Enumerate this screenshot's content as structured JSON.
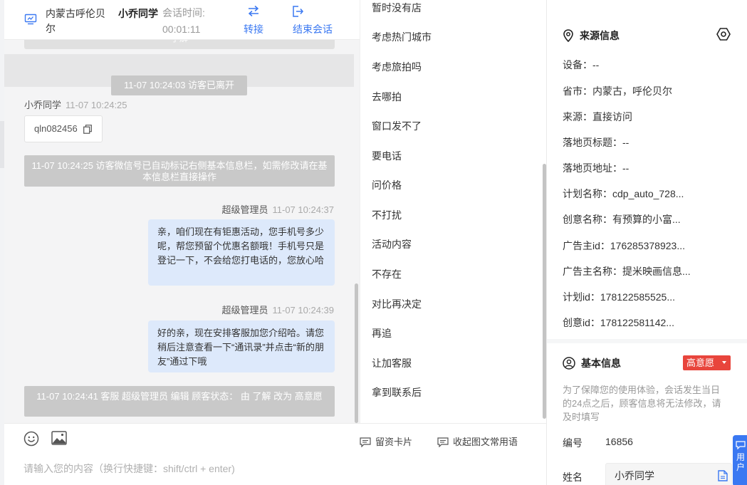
{
  "header": {
    "location": "内蒙古呼伦贝尔",
    "visitor_name": "小乔同学",
    "time_label": "会话时间:",
    "time_value": "00:01:11",
    "transfer_label": "转接",
    "end_label": "结束会话"
  },
  "chat": {
    "cut_text": "了解",
    "left_event": "11-07 10:24:03 访客已离开",
    "visitor_meta": {
      "name": "小乔同学",
      "time": "11-07 10:24:25"
    },
    "wechat_id": "qln082456",
    "system_note_1": "11-07 10:24:25 访客微信号已自动标记右侧基本信息栏，如需修改请在基本信息栏直接操作",
    "agent_msg_1": {
      "name": "超级管理员",
      "time": "11-07 10:24:37",
      "text": "亲，咱们现在有钜惠活动，您手机号多少呢，帮您预留个优惠名额哦！手机号只是登记一下，不会给您打电话的，您放心哈"
    },
    "agent_msg_2": {
      "name": "超级管理员",
      "time": "11-07 10:24:39",
      "text": "好的亲，现在安排客服加您介绍哈。请您稍后注意查看一下“通讯录”并点击“新的朋友”通过下哦"
    },
    "system_note_2": "11-07 10:24:41 客服 超级管理员 编辑 顾客状态： 由 了解 改为 高意愿"
  },
  "composer": {
    "card_label": "留资卡片",
    "phrase_label": "收起图文常用语",
    "placeholder": "请输入您的内容（换行快捷键：shift/ctrl + enter)"
  },
  "quick_replies": [
    "暂时没有店",
    "考虑热门城市",
    "考虑旅拍吗",
    "去哪拍",
    "窗口发不了",
    "要电话",
    "问价格",
    "不打扰",
    "活动内容",
    "不存在",
    "对比再决定",
    "再追",
    "让加客服",
    "拿到联系后"
  ],
  "source_info": {
    "title": "来源信息",
    "rows": [
      "设备：--",
      "省市：内蒙古，呼伦贝尔",
      "来源：直接访问",
      "落地页标题：--",
      "落地页地址：--",
      "计划名称：cdp_auto_728...",
      "创意名称：有预算的小富...",
      "广告主id：176285378923...",
      "广告主名称：提米映画信息...",
      "计划id：178122585525...",
      "创意id：178122581142..."
    ]
  },
  "basic_info": {
    "title": "基本信息",
    "intent_badge": "高意愿",
    "note": "为了保障您的使用体验，会话发生当日的24点之后，顾客信息将无法修改，请及时填写",
    "id_label": "编号",
    "id_value": "16856",
    "name_label": "姓名",
    "name_value": "小乔同学"
  },
  "float_tab_label": "用户",
  "colors": {
    "accent": "#3a78f2",
    "agent_bubble": "#dde9fb",
    "system_note": "#c9c9c9",
    "intent_badge": "#e8453c"
  }
}
